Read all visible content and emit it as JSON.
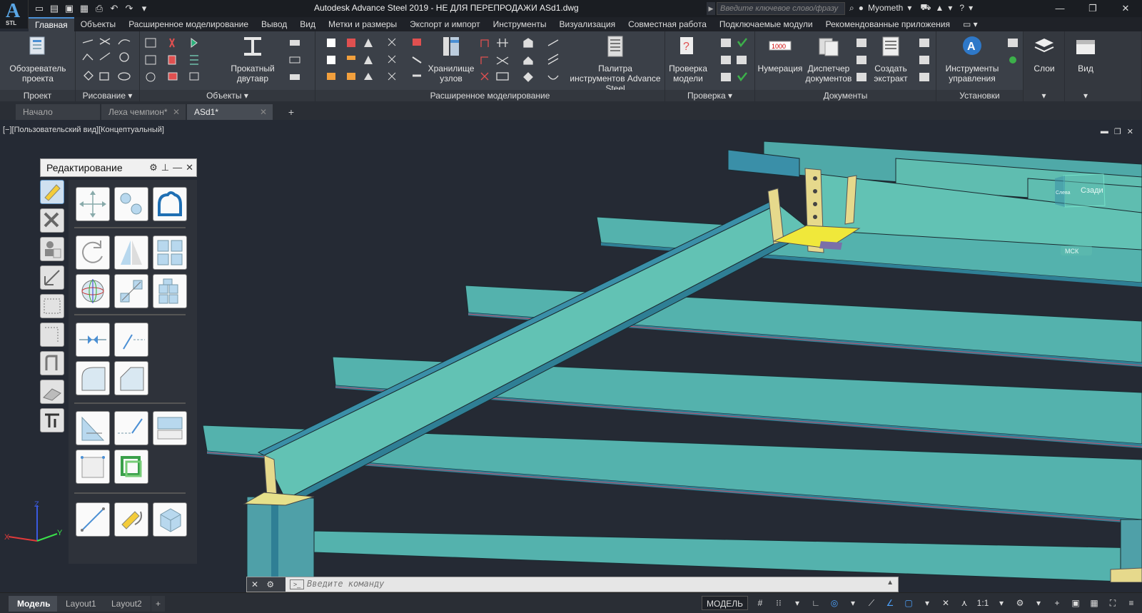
{
  "app": {
    "logo_text": "A",
    "logo_sub": "STL",
    "title": "Autodesk Advance Steel 2019 - НЕ ДЛЯ ПЕРЕПРОДАЖИ    ASd1.dwg",
    "search_placeholder": "Введите ключевое слово/фразу",
    "user": "Myometh"
  },
  "ribbon_tabs": [
    "Главная",
    "Объекты",
    "Расширенное моделирование",
    "Вывод",
    "Вид",
    "Метки и размеры",
    "Экспорт и импорт",
    "Инструменты",
    "Визуализация",
    "Совместная работа",
    "Подключаемые модули",
    "Рекомендованные приложения"
  ],
  "ribbon": {
    "project_browser": "Обозреватель проекта",
    "rolled_ibeam": "Прокатный двутавр",
    "node_storage": "Хранилище узлов",
    "tool_palette": "Палитра инструментов Advance Steel",
    "model_check": "Проверка модели",
    "numbering": "Нумерация",
    "doc_manager": "Диспетчер документов",
    "create_extract": "Создать экстракт",
    "mgmt_tools": "Инструменты управления",
    "layers": "Слои",
    "view": "Вид",
    "groups": {
      "project": "Проект",
      "drawing": "Рисование",
      "objects": "Объекты",
      "advanced": "Расширенное моделирование",
      "check": "Проверка",
      "documents": "Документы",
      "settings": "Установки"
    }
  },
  "doc_tabs": [
    "Начало",
    "Леха чемпион*",
    "ASd1*"
  ],
  "viewport": {
    "label": "[−][Пользовательский вид][Концептуальный]",
    "cube_face": "Сзади",
    "cube_side": "Слева",
    "mck": "МСК"
  },
  "palette": {
    "title": "Редактирование"
  },
  "ucs": {
    "x": "X",
    "y": "Y",
    "z": "Z"
  },
  "command": {
    "placeholder": "Введите команду"
  },
  "layouts": [
    "Модель",
    "Layout1",
    "Layout2"
  ],
  "status": {
    "model": "МОДЕЛЬ",
    "scale": "1:1"
  },
  "colors": {
    "beam_top": "#5fbdb0",
    "beam_side": "#3a8fa8",
    "plate": "#e6d98c",
    "background": "#252a34",
    "accent": "#4a8fd4"
  }
}
